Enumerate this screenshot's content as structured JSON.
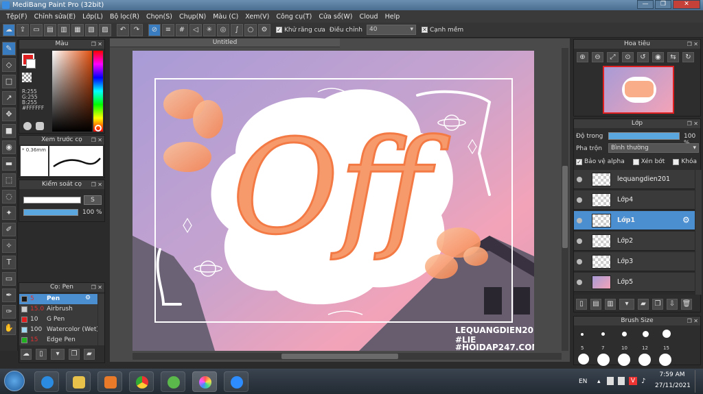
{
  "window": {
    "title": "MediBang Paint Pro (32bit)",
    "min": "—",
    "max": "❐",
    "close": "✕"
  },
  "menu": [
    "Tệp(F)",
    "Chỉnh sửa(E)",
    "Lớp(L)",
    "Bộ lọc(R)",
    "Chọn(S)",
    "Chụp(N)",
    "Màu (C)",
    "Xem(V)",
    "Công cụ(T)",
    "Cửa sổ(W)",
    "Cloud",
    "Help"
  ],
  "toolbar": {
    "antialias_label": "Khử răng cưa",
    "correction_label": "Điều chỉnh",
    "correction_value": "40",
    "soft_edge_label": "Cạnh mềm"
  },
  "color_panel": {
    "title": "Màu",
    "r": "R:255",
    "g": "G:255",
    "b": "B:255",
    "hex": "#FFFFFF"
  },
  "brush_preview": {
    "title": "Xem trước cọ",
    "size": "* 0.36mm"
  },
  "brush_control": {
    "title": "Kiểm soát cọ",
    "size_btn": "S",
    "opacity": "100 %"
  },
  "brush_list": {
    "title": "Cọ: Pen",
    "items": [
      {
        "size": "5",
        "name": "Pen",
        "color": "#1a1a1a"
      },
      {
        "size": "15.0",
        "name": "Airbrush",
        "color": "#cccccc"
      },
      {
        "size": "10",
        "name": "G Pen",
        "color": "#e02020"
      },
      {
        "size": "100",
        "name": "Watercolor (Wet)",
        "color": "#9fd8f0"
      },
      {
        "size": "15",
        "name": "Edge Pen",
        "color": "#20b020"
      }
    ]
  },
  "document": {
    "tab": "Untitled"
  },
  "artwork": {
    "main_text": "Off",
    "watermark": [
      "LEQUANGDIEN201",
      "#LIE",
      "#HOIDAP247.COM"
    ]
  },
  "navigator": {
    "title": "Hoa tiêu"
  },
  "layer_panel": {
    "title": "Lớp",
    "opacity_label": "Độ trong",
    "opacity_value": "100 %",
    "blend_label": "Pha trộn",
    "blend_value": "Bình thường",
    "protect_alpha": "Bảo vệ alpha",
    "clipping": "Xén bớt",
    "lock": "Khóa",
    "layers": [
      {
        "name": "lequangdien201",
        "selected": false
      },
      {
        "name": "Lớp4",
        "selected": false
      },
      {
        "name": "Lớp1",
        "selected": true
      },
      {
        "name": "Lớp2",
        "selected": false
      },
      {
        "name": "Lớp3",
        "selected": false
      },
      {
        "name": "Lớp5",
        "selected": false
      }
    ]
  },
  "brush_size": {
    "title": "Brush Size",
    "sizes": [
      "5",
      "7",
      "10",
      "12",
      "15"
    ]
  },
  "taskbar": {
    "lang": "EN",
    "time": "7:59 AM",
    "date": "27/11/2021"
  },
  "colors": {
    "accent": "#4b8fd0",
    "orange": "#f79a6b",
    "sky_top": "#a89bd6",
    "sky_pink": "#f3a3b8"
  }
}
